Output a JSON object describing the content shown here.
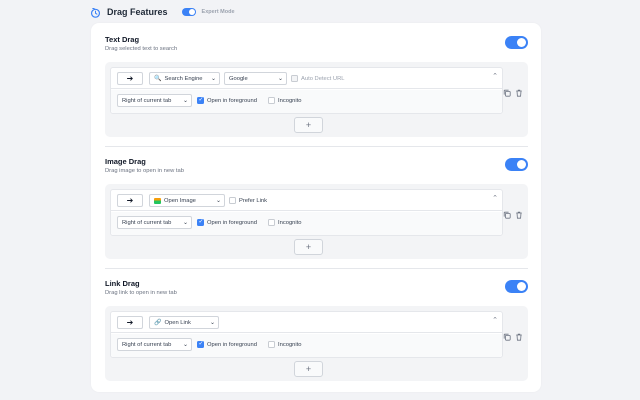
{
  "header": {
    "title": "Drag Features",
    "mode_label": "Expert Mode"
  },
  "sections": [
    {
      "title": "Text Drag",
      "description": "Drag selected text to search",
      "rule": {
        "arrow": "➔",
        "action_label": "Search Engine",
        "engine_label": "Google",
        "auto_detect_label": "Auto Detect URL",
        "position_label": "Right of current tab",
        "foreground_label": "Open in foreground",
        "incognito_label": "Incognito"
      },
      "add_label": "+"
    },
    {
      "title": "Image Drag",
      "description": "Drag image to open in new tab",
      "rule": {
        "arrow": "➔",
        "action_label": "Open Image",
        "prefer_link_label": "Prefer Link",
        "position_label": "Right of current tab",
        "foreground_label": "Open in foreground",
        "incognito_label": "Incognito"
      },
      "add_label": "+"
    },
    {
      "title": "Link Drag",
      "description": "Drag link to open in new tab",
      "rule": {
        "arrow": "➔",
        "action_label": "Open Link",
        "position_label": "Right of current tab",
        "foreground_label": "Open in foreground",
        "incognito_label": "Incognito"
      },
      "add_label": "+"
    }
  ],
  "icons": {
    "logo": "drag-clock-icon",
    "search": "magnifier-icon",
    "image": "image-icon",
    "link": "link-icon",
    "copy": "copy-icon",
    "delete": "trash-icon",
    "collapse": "chevron-up-icon"
  },
  "colors": {
    "accent": "#3b82f6",
    "background": "#f2f3f6",
    "card": "#ffffff"
  }
}
